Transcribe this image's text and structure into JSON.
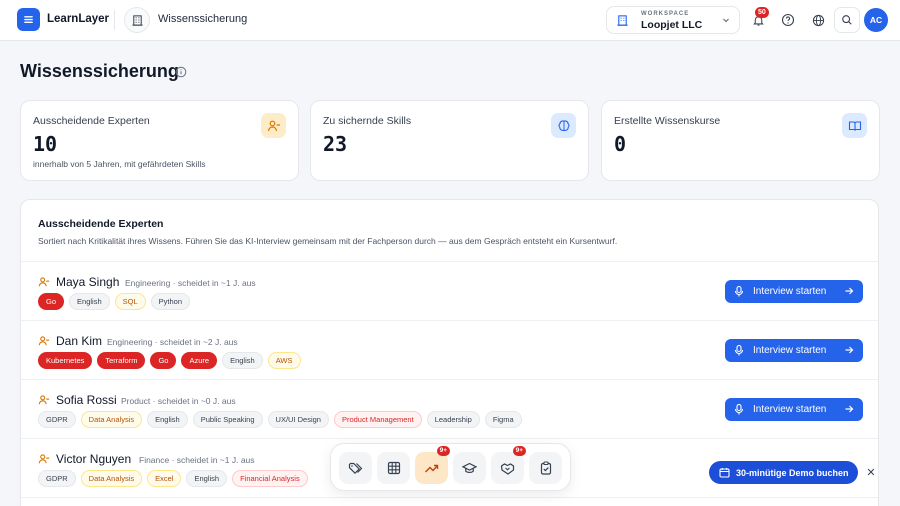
{
  "header": {
    "brand": "LearnLayer",
    "breadcrumb": "Wissenssicherung",
    "workspace_label": "WORKSPACE",
    "workspace_value": "Loopjet LLC",
    "notifications_count": "50",
    "avatar_initials": "AC"
  },
  "page": {
    "title": "Wissenssicherung"
  },
  "kpis": [
    {
      "label": "Ausscheidende Experten",
      "value": "10",
      "sub": "innerhalb von 5 Jahren, mit gefährdeten Skills",
      "icon": "user-minus-icon"
    },
    {
      "label": "Zu sichernde Skills",
      "value": "23",
      "sub": "",
      "icon": "brain-icon"
    },
    {
      "label": "Erstellte Wissenskurse",
      "value": "0",
      "sub": "",
      "icon": "book-open-icon"
    }
  ],
  "experts_panel": {
    "title": "Ausscheidende Experten",
    "description": "Sortiert nach Kritikalität ihres Wissens. Führen Sie das KI-Interview gemeinsam mit der Fachperson durch — aus dem Gespräch entsteht ein Kursentwurf.",
    "button_label": "Interview starten",
    "experts": [
      {
        "name": "Maya Singh",
        "meta": "Engineering · scheidet in ~1 J. aus",
        "tags": [
          {
            "t": "Go",
            "k": "red"
          },
          {
            "t": "English",
            "k": "gray"
          },
          {
            "t": "SQL",
            "k": "amber"
          },
          {
            "t": "Python",
            "k": "gray"
          }
        ],
        "has_button": true
      },
      {
        "name": "Dan Kim",
        "meta": "Engineering · scheidet in ~2 J. aus",
        "tags": [
          {
            "t": "Kubernetes",
            "k": "red"
          },
          {
            "t": "Terraform",
            "k": "red"
          },
          {
            "t": "Go",
            "k": "red"
          },
          {
            "t": "Azure",
            "k": "red"
          },
          {
            "t": "English",
            "k": "gray"
          },
          {
            "t": "AWS",
            "k": "amber"
          }
        ],
        "has_button": true
      },
      {
        "name": "Sofia Rossi",
        "meta": "Product · scheidet in ~0 J. aus",
        "tags": [
          {
            "t": "GDPR",
            "k": "gray"
          },
          {
            "t": "Data Analysis",
            "k": "amber"
          },
          {
            "t": "English",
            "k": "gray"
          },
          {
            "t": "Public Speaking",
            "k": "gray"
          },
          {
            "t": "UX/UI Design",
            "k": "gray"
          },
          {
            "t": "Product Management",
            "k": "pink"
          },
          {
            "t": "Leadership",
            "k": "gray"
          },
          {
            "t": "Figma",
            "k": "gray"
          }
        ],
        "has_button": true
      },
      {
        "name": "Victor Nguyen",
        "meta": "Finance · scheidet in ~1 J. aus",
        "tags": [
          {
            "t": "GDPR",
            "k": "gray"
          },
          {
            "t": "Data Analysis",
            "k": "amber"
          },
          {
            "t": "Excel",
            "k": "amber"
          },
          {
            "t": "English",
            "k": "gray"
          },
          {
            "t": "Financial Analysis",
            "k": "pink"
          }
        ],
        "has_button": false
      }
    ]
  },
  "dock": {
    "items": [
      {
        "icon": "tags-icon",
        "badge": ""
      },
      {
        "icon": "grid-icon",
        "badge": ""
      },
      {
        "icon": "trending-up-icon",
        "badge": "9+",
        "active": true
      },
      {
        "icon": "graduation-cap-icon",
        "badge": ""
      },
      {
        "icon": "handshake-icon",
        "badge": "9+"
      },
      {
        "icon": "clipboard-check-icon",
        "badge": ""
      }
    ]
  },
  "demo": {
    "label": "30-minütige Demo buchen",
    "close": "✕"
  },
  "colors": {
    "primary": "#2563eb",
    "danger": "#dc2626",
    "amber_bg": "#fde7c7"
  }
}
